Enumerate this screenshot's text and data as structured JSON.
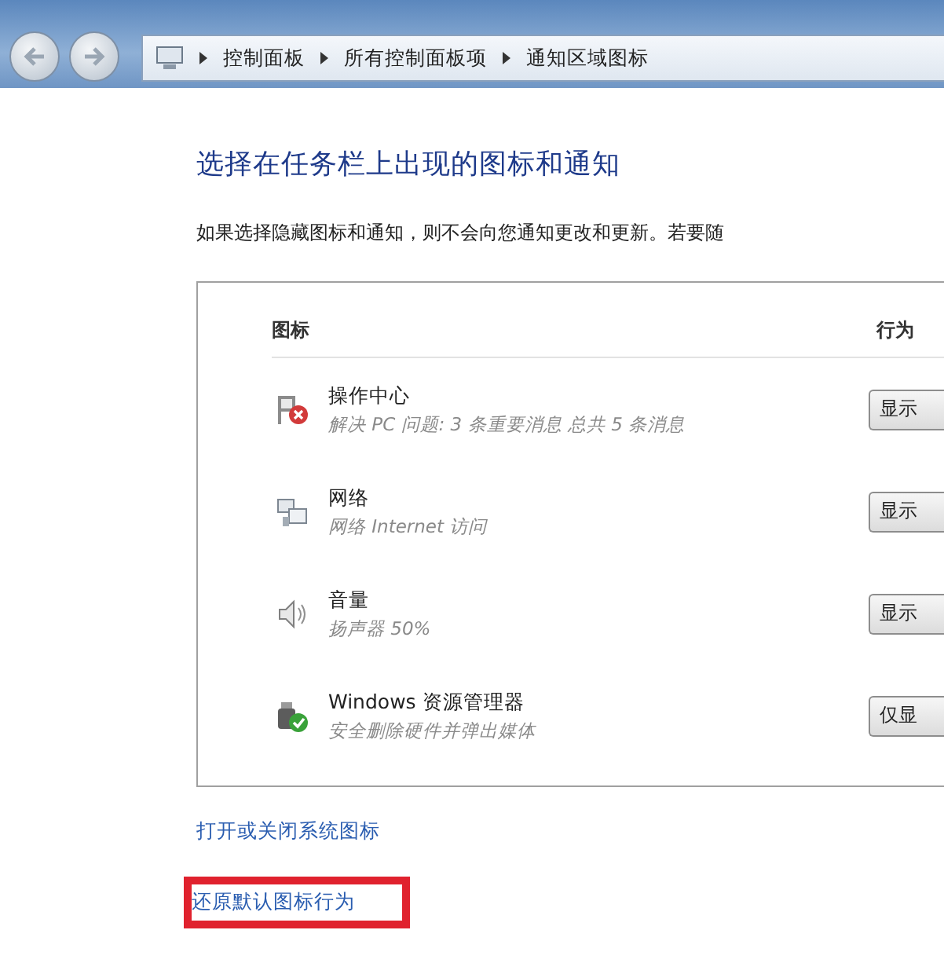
{
  "address_bar": {
    "breadcrumbs": [
      "控制面板",
      "所有控制面板项",
      "通知区域图标"
    ]
  },
  "heading": "选择在任务栏上出现的图标和通知",
  "intro": "如果选择隐藏图标和通知，则不会向您通知更改和更新。若要随",
  "table": {
    "columns": [
      "图标",
      "行为"
    ],
    "rows": [
      {
        "name": "操作中心",
        "detail": "解决 PC 问题: 3 条重要消息 总共 5 条消息",
        "behavior": "显示"
      },
      {
        "name": "网络",
        "detail": "网络 Internet 访问",
        "behavior": "显示"
      },
      {
        "name": "音量",
        "detail": "扬声器 50%",
        "behavior": "显示"
      },
      {
        "name": "Windows 资源管理器",
        "detail": "安全删除硬件并弹出媒体",
        "behavior": "仅显"
      }
    ]
  },
  "links": [
    {
      "text": "打开或关闭系统图标",
      "highlighted": false
    },
    {
      "text": "还原默认图标行为",
      "highlighted": true
    }
  ]
}
